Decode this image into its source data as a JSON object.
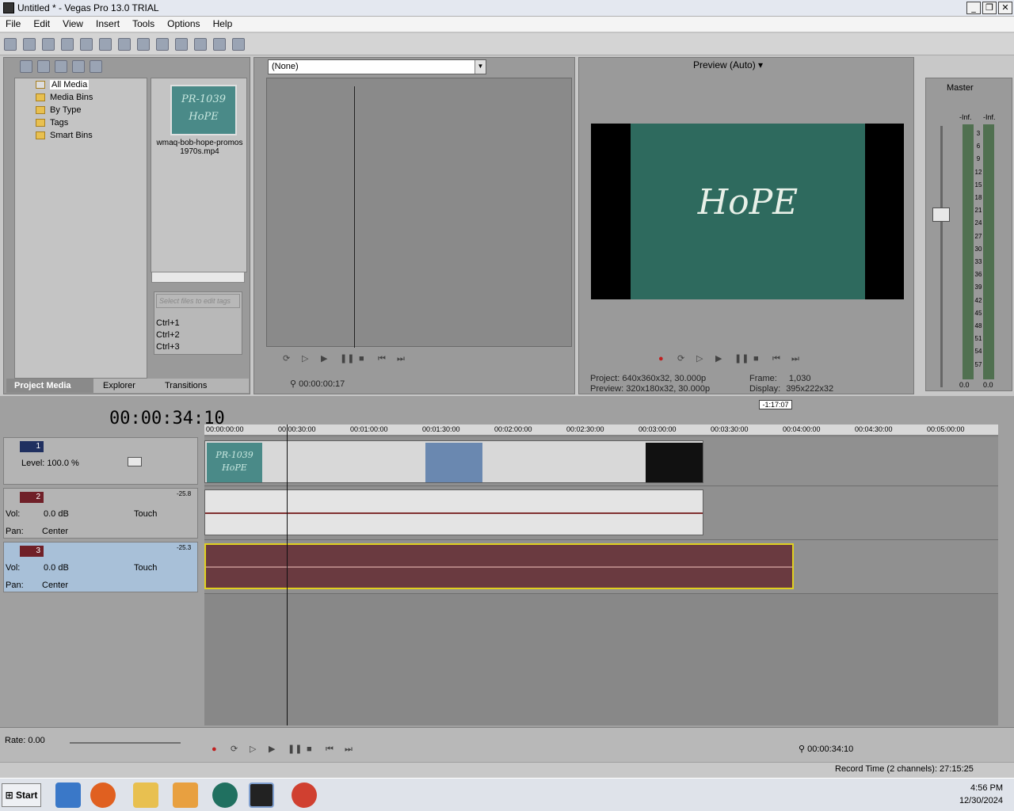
{
  "window": {
    "title": "Untitled * - Vegas Pro 13.0 TRIAL"
  },
  "menu": [
    "File",
    "Edit",
    "View",
    "Insert",
    "Tools",
    "Options",
    "Help"
  ],
  "explorer": {
    "tree": [
      "All Media",
      "Media Bins",
      "By Type",
      "Tags",
      "Smart Bins"
    ],
    "media_file": "wmaq-bob-hope-promos 1970s.mp4",
    "thumb_text": "PR-1039 HoPE",
    "tag_placeholder": "Select files to edit tags",
    "shortcuts": [
      "Ctrl+1",
      "Ctrl+2",
      "Ctrl+3"
    ],
    "tabs": [
      "Project Media",
      "Explorer",
      "Transitions"
    ]
  },
  "trimmer": {
    "select_value": "(None)",
    "timecode": "00:00:00:17"
  },
  "preview": {
    "mode": "Preview (Auto)",
    "image_text": "HoPE",
    "project_label": "Project:",
    "project_value": "640x360x32, 30.000p",
    "preview_label": "Preview:",
    "preview_value": "320x180x32, 30.000p",
    "frame_label": "Frame:",
    "frame_value": "1,030",
    "display_label": "Display:",
    "display_value": "395x222x32"
  },
  "master": {
    "label": "Master",
    "inf_left": "-Inf.",
    "inf_right": "-Inf.",
    "scale": [
      "3",
      "6",
      "9",
      "12",
      "15",
      "18",
      "21",
      "24",
      "27",
      "30",
      "33",
      "36",
      "39",
      "42",
      "45",
      "48",
      "51",
      "54",
      "57"
    ],
    "bottom_left": "0.0",
    "bottom_right": "0.0"
  },
  "timeline": {
    "timecode": "00:00:34:10",
    "marker_time": "-1:17:07",
    "ruler": [
      "00:00:00:00",
      "00:00:30:00",
      "00:01:00:00",
      "00:01:30:00",
      "00:02:00:00",
      "00:02:30:00",
      "00:03:00:00",
      "00:03:30:00",
      "00:04:00:00",
      "00:04:30:00",
      "00:05:00:00"
    ],
    "tracks": [
      {
        "num": "1",
        "type": "video",
        "level_label": "Level:",
        "level": "100.0 %"
      },
      {
        "num": "2",
        "type": "audio",
        "vol_label": "Vol:",
        "vol": "0.0 dB",
        "pan_label": "Pan:",
        "pan": "Center",
        "auto": "Touch",
        "peak": "-25.8"
      },
      {
        "num": "3",
        "type": "audio",
        "vol_label": "Vol:",
        "vol": "0.0 dB",
        "pan_label": "Pan:",
        "pan": "Center",
        "auto": "Touch",
        "peak": "-25.3"
      }
    ],
    "rate": "Rate: 0.00",
    "bottom_timecode": "00:00:34:10",
    "record_time": "Record Time (2 channels): 27:15:25"
  },
  "taskbar": {
    "start": "Start",
    "time": "4:56 PM",
    "date": "12/30/2024"
  },
  "colors": {
    "audio_selected": "#6a3a40",
    "selection_border": "#e0d020",
    "video_track": "#203060",
    "audio_track": "#702028"
  }
}
